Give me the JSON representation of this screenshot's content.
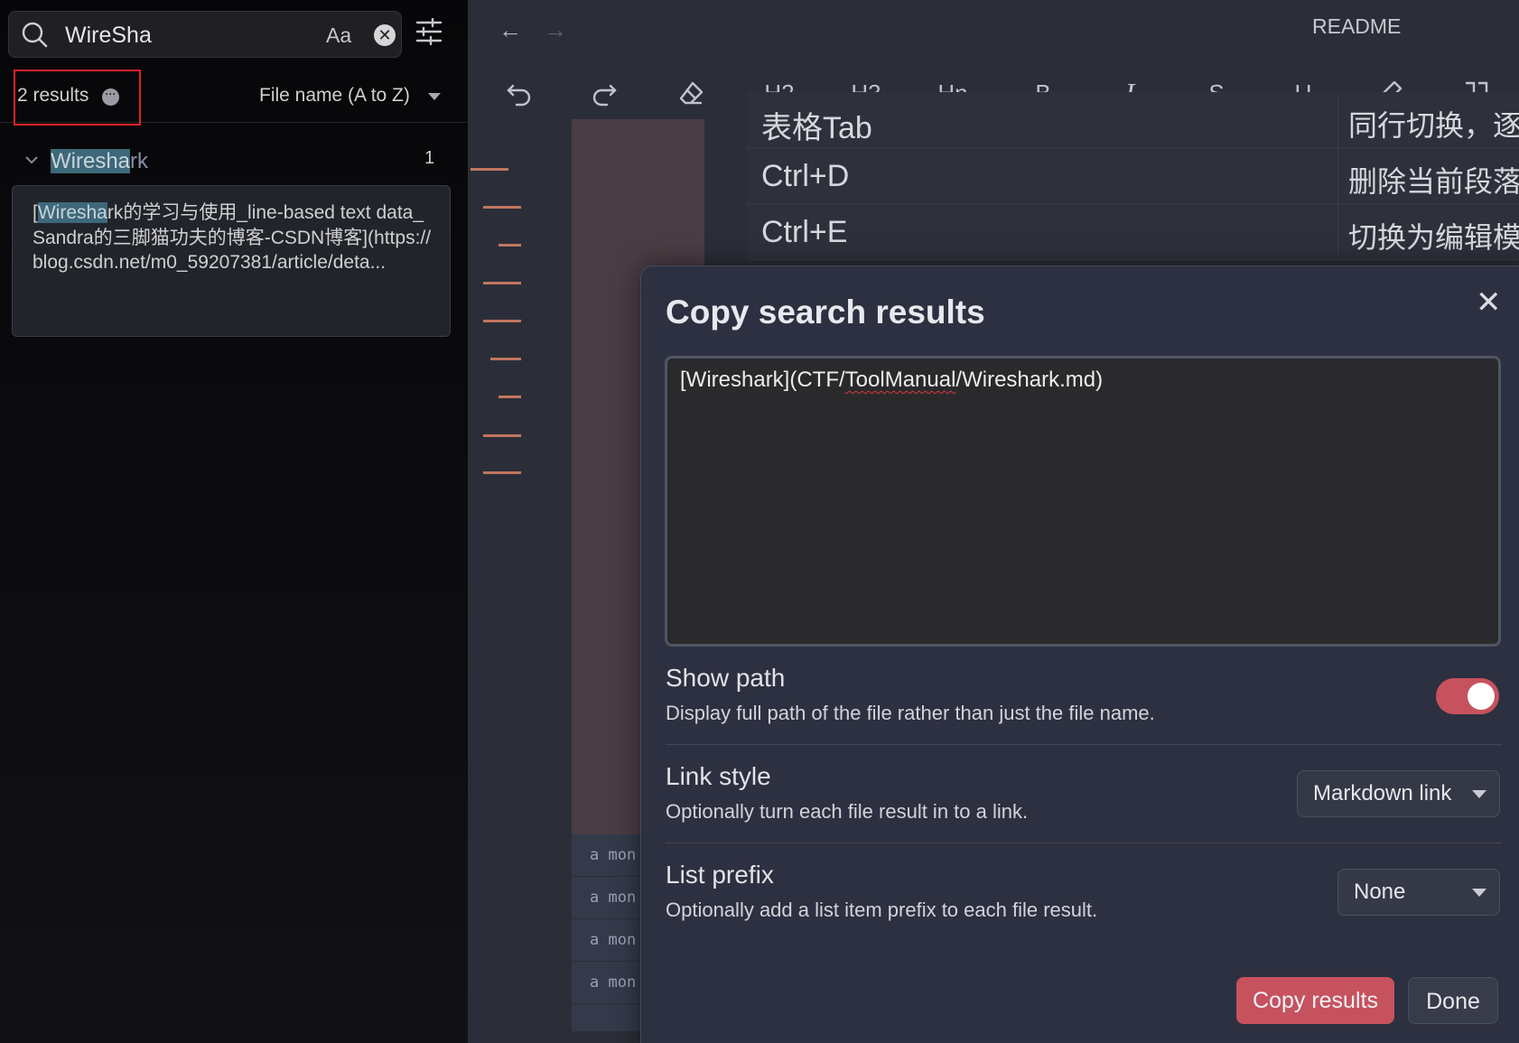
{
  "search": {
    "query": "WireSha",
    "case_toggle": "Aa",
    "clear_glyph": "✕",
    "results_count": "2 results",
    "sort_label": "File name (A to Z)"
  },
  "results": {
    "file": {
      "name_highlight": "Wiresha",
      "name_rest": "rk",
      "match_count": "1"
    },
    "snippet": {
      "prefix": "[",
      "highlight": "Wiresha",
      "rest": "rk的学习与使用_line-based text data_Sandra的三脚猫功夫的博客-CSDN博客](https://blog.csdn.net/m0_59207381/article/deta..."
    }
  },
  "editor": {
    "title": "README",
    "nav_back": "←",
    "nav_forward": "→",
    "toolbar": {
      "h2": "H2",
      "h3": "H3",
      "hn": "Hn",
      "bold": "B",
      "italic": "I",
      "strike": "S",
      "underline": "U"
    },
    "table_rows": [
      {
        "key": "表格Tab",
        "action": "同行切换，逐"
      },
      {
        "key": "Ctrl+D",
        "action": "删除当前段落"
      },
      {
        "key": "Ctrl+E",
        "action": "切换为编辑模"
      }
    ],
    "bottom_items": [
      "a mon",
      "a mon",
      "a mon",
      "a mon"
    ]
  },
  "modal": {
    "title": "Copy search results",
    "close_glyph": "✕",
    "output_parts": {
      "pre": "[Wireshark](CTF/",
      "flagged": "ToolManual",
      "post": "/Wireshark.md)"
    },
    "show_path": {
      "label": "Show path",
      "description": "Display full path of the file rather than just the file name.",
      "enabled": true
    },
    "link_style": {
      "label": "Link style",
      "description": "Optionally turn each file result in to a link.",
      "selected": "Markdown link"
    },
    "list_prefix": {
      "label": "List prefix",
      "description": "Optionally add a list item prefix to each file result.",
      "selected": "None"
    },
    "copy_button": "Copy results",
    "done_button": "Done"
  },
  "colors": {
    "accent": "#c6525e",
    "highlight_bg": "#3d6879",
    "annotation_box": "#e0222b",
    "outline_marker": "#c0765e"
  }
}
